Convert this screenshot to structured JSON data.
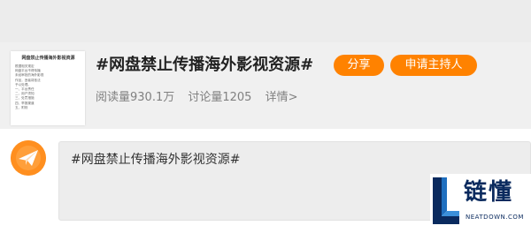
{
  "topic": {
    "title": "#网盘禁止传播海外影视资源#",
    "cover_title": "网盘禁止传播海外影视资源",
    "cover_body": "根据相关规定\n网盘平台不得传播\n未经审批的海外影视\n作品，违者将依法\n予以处理。\n一、平台责任\n二、用户须知\n三、处罚措施\n四、举报渠道\n五、附则",
    "stats": {
      "reads": "阅读量930.1万",
      "discussions": "讨论量1205",
      "details": "详情>"
    }
  },
  "buttons": {
    "share": "分享",
    "apply_host": "申请主持人"
  },
  "compose": {
    "text": "#网盘禁止传播海外影视资源#"
  },
  "watermark": {
    "name": "链懂",
    "url": "NEATDOWN.COM"
  },
  "colors": {
    "accent": "#ff8200",
    "header_bg": "#f0f0f0",
    "compose_bg": "#ededed",
    "logo_blue": "#0a2a5e"
  },
  "icons": {
    "avatar": "paper-plane-icon",
    "logo": "l-shape-logo-icon"
  }
}
